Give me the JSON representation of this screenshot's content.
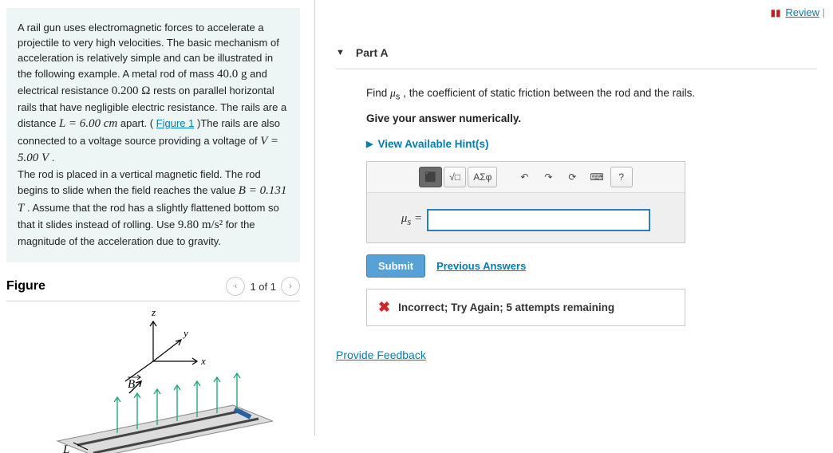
{
  "review": {
    "label": "Review"
  },
  "problem": {
    "p1a": "A rail gun uses electromagnetic forces to accelerate a projectile to very high velocities. The basic mechanism of acceleration is relatively simple and can be illustrated in the following example. A metal rod of mass ",
    "mass": "40.0 g",
    "p1b": " and electrical resistance ",
    "resistance": "0.200 Ω",
    "p1c": " rests on parallel horizontal rails that have negligible electric resistance. The rails are a distance ",
    "L_eq": "L = 6.00 cm",
    "p1d": " apart. (",
    "fig_link": "Figure 1",
    "p1e": ")The rails are also connected to a voltage source providing a voltage of ",
    "V_eq": "V = 5.00 V",
    "p1f": " .",
    "p2a": "The rod is placed in a vertical magnetic field. The rod begins to slide when the field reaches the value ",
    "B_eq": "B = 0.131 T",
    "p2b": " . Assume that the rod has a slightly flattened bottom so that it slides instead of rolling. Use ",
    "g_val": "9.80 m/s²",
    "p2c": " for the magnitude of the acceleration due to gravity."
  },
  "figure": {
    "heading": "Figure",
    "counter": "1 of 1",
    "z": "z",
    "y": "y",
    "x": "x",
    "B": "B",
    "L": "L"
  },
  "part": {
    "label": "Part A",
    "prompt_a": "Find ",
    "mu": "μ",
    "sub": "s",
    "prompt_b": " , the coefficient of static friction between the rod and the rails.",
    "instruction": "Give your answer numerically.",
    "hints": "View Available Hint(s)",
    "lhs": "μ",
    "lhs_sub": "s",
    "eq": " = "
  },
  "toolbar": {
    "templates": "⬛",
    "sqrt": "√□",
    "greek": "ΑΣφ",
    "undo": "↶",
    "redo": "↷",
    "reset": "⟳",
    "keyboard": "⌨",
    "help": "?"
  },
  "buttons": {
    "submit": "Submit",
    "previous": "Previous Answers"
  },
  "feedback": {
    "text": "Incorrect; Try Again; 5 attempts remaining"
  },
  "provide_feedback": "Provide Feedback"
}
